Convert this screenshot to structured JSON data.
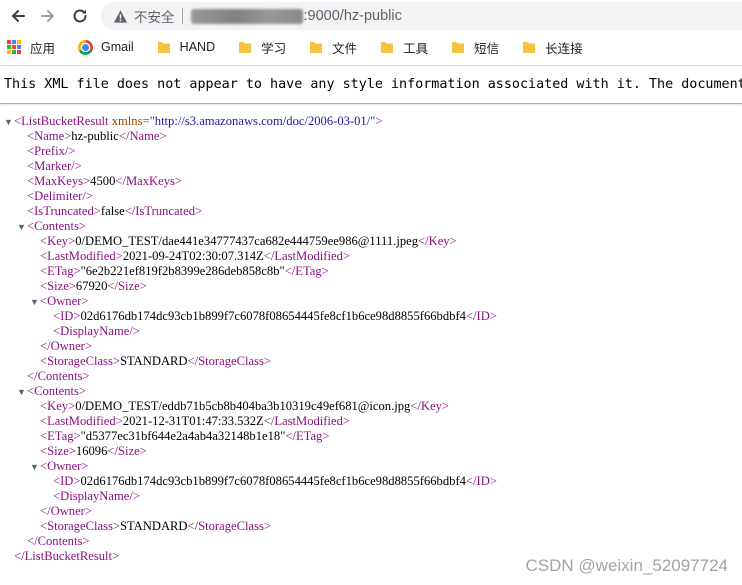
{
  "browser": {
    "insecure_label": "不安全",
    "url_suffix": ":9000/hz-public"
  },
  "bookmarks": [
    {
      "label": "应用",
      "icon": "apps-grid-icon"
    },
    {
      "label": "Gmail",
      "icon": "chrome-icon"
    },
    {
      "label": "HAND",
      "icon": "folder-icon"
    },
    {
      "label": "学习",
      "icon": "folder-icon"
    },
    {
      "label": "文件",
      "icon": "folder-icon"
    },
    {
      "label": "工具",
      "icon": "folder-icon"
    },
    {
      "label": "短信",
      "icon": "folder-icon"
    },
    {
      "label": "长连接",
      "icon": "folder-icon"
    }
  ],
  "notice": "This XML file does not appear to have any style information associated with it. The document tree is shown below.",
  "xml": {
    "root_tag": "ListBucketResult",
    "root_attr_name": "xmlns",
    "root_attr_value": "\"http://s3.amazonaws.com/doc/2006-03-01/\"",
    "name": "hz-public",
    "max_keys": "4500",
    "is_truncated": "false",
    "contents": [
      {
        "key": "0/DEMO_TEST/dae441e34777437ca682e444759ee986@1111.jpeg",
        "last_modified": "2021-09-24T02:30:07.314Z",
        "etag": "\"6e2b221ef819f2b8399e286deb858c8b\"",
        "size": "67920",
        "owner_id": "02d6176db174dc93cb1b899f7c6078f08654445fe8cf1b6ce98d8855f66bdbf4",
        "storage_class": "STANDARD"
      },
      {
        "key": "0/DEMO_TEST/eddb71b5cb8b404ba3b10319c49ef681@icon.jpg",
        "last_modified": "2021-12-31T01:47:33.532Z",
        "etag": "\"d5377ec31bf644e2a4ab4a32148b1e18\"",
        "size": "16096",
        "owner_id": "02d6176db174dc93cb1b899f7c6078f08654445fe8cf1b6ce98d8855f66bdbf4",
        "storage_class": "STANDARD"
      }
    ]
  },
  "watermark": "CSDN @weixin_52097724",
  "colors": {
    "tag": "#881280",
    "attr_name": "#994500",
    "attr_value": "#1a1aa6",
    "bookmark_folder": "#f5c342"
  }
}
